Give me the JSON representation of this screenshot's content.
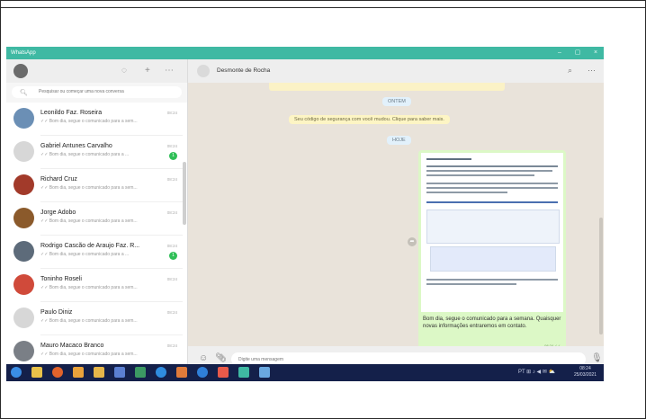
{
  "window": {
    "title": "WhatsApp",
    "controls": {
      "minimize": "–",
      "maximize": "▢",
      "close": "×"
    }
  },
  "left": {
    "search_placeholder": "Pesquisar ou começar uma nova conversa",
    "chats": [
      {
        "name": "Leonildo Faz. Roseira",
        "snippet": "✓✓ Bom dia, segue o comunicado para a sem...",
        "time": "08:24",
        "badge": "",
        "avatar_color": "#6b8fb5"
      },
      {
        "name": "Gabriel Antunes Carvalho",
        "snippet": "✓✓ Bom dia, segue o comunicado para a ...",
        "time": "08:24",
        "badge": "1",
        "avatar_color": "#d7d7d7"
      },
      {
        "name": "Richard Cruz",
        "snippet": "✓✓ Bom dia, segue o comunicado para a sem...",
        "time": "08:24",
        "badge": "",
        "avatar_color": "#a23a2a"
      },
      {
        "name": "Jorge Adobo",
        "snippet": "✓✓ Bom dia, segue o comunicado para a sem...",
        "time": "08:24",
        "badge": "",
        "avatar_color": "#8b5a2b"
      },
      {
        "name": "Rodrigo Cascão de Araujo Faz. R...",
        "snippet": "✓✓ Bom dia, segue o comunicado para a ...",
        "time": "08:24",
        "badge": "1",
        "avatar_color": "#5d6b7a"
      },
      {
        "name": "Toninho Roseli",
        "snippet": "✓✓ Bom dia, segue o comunicado para a sem...",
        "time": "08:24",
        "badge": "",
        "avatar_color": "#d04a3a"
      },
      {
        "name": "Paulo Diniz",
        "snippet": "✓✓ Bom dia, segue o comunicado para a sem...",
        "time": "08:24",
        "badge": "",
        "avatar_color": "#d7d7d7"
      },
      {
        "name": "Mauro Macaco Branco",
        "snippet": "✓✓ Bom dia, segue o comunicado para a sem...",
        "time": "08:24",
        "badge": "",
        "avatar_color": "#7a7f86"
      }
    ]
  },
  "conversation": {
    "contact": "Desmonte de Rocha",
    "date_pill_1": "ONTEM",
    "security_notice": "Seu código de segurança com você mudou. Clique para saber mais.",
    "date_pill_2": "HOJE",
    "message_caption": "Bom dia, segue o comunicado para a semana. Quaisquer novas informações entraremos em contato.",
    "message_time": "08:24 ✓✓",
    "input_placeholder": "Digite uma mensagem"
  },
  "taskbar": {
    "tray": "PT  ⊞  ♪  ◀  ✉  ⛅",
    "time": "08:24",
    "date": "25/03/2021"
  }
}
